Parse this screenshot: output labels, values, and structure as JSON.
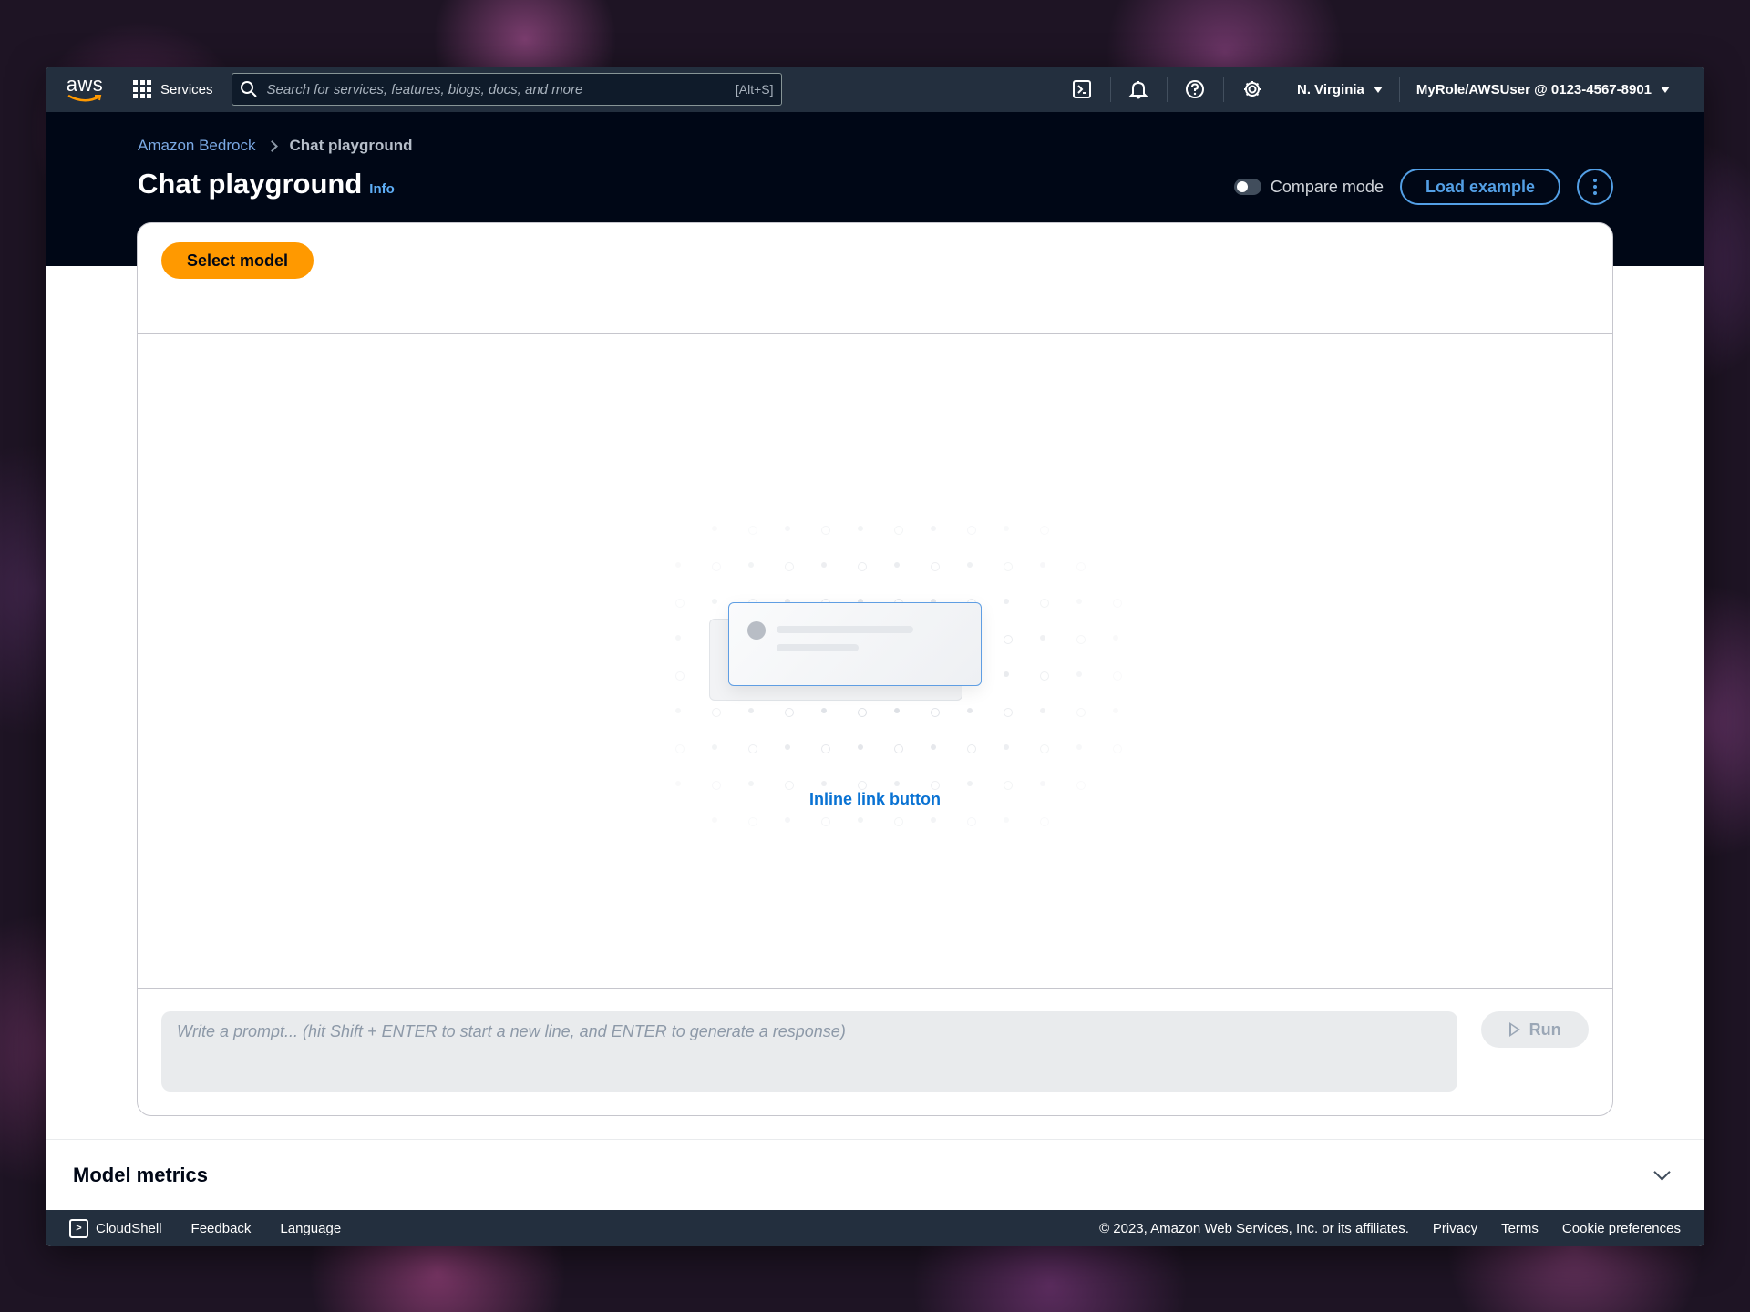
{
  "nav": {
    "logo": "aws",
    "services_label": "Services",
    "search_placeholder": "Search for services, features, blogs, docs, and more",
    "search_shortcut": "[Alt+S]",
    "icons": [
      "cloudshell-icon",
      "bell-icon",
      "help-icon",
      "gear-icon"
    ],
    "region": "N. Virginia",
    "account": "MyRole/AWSUser @ 0123-4567-8901"
  },
  "breadcrumb": {
    "parent": "Amazon Bedrock",
    "current": "Chat playground"
  },
  "header": {
    "title": "Chat playground",
    "info": "Info",
    "compare_mode": "Compare mode",
    "load_example": "Load example"
  },
  "playground": {
    "select_model": "Select model",
    "empty_link": "Inline link button",
    "prompt_placeholder": "Write a prompt... (hit Shift + ENTER to start a new line, and ENTER to generate a response)",
    "run": "Run"
  },
  "metrics": {
    "title": "Model metrics"
  },
  "footer": {
    "cloudshell": "CloudShell",
    "feedback": "Feedback",
    "language": "Language",
    "copyright": "© 2023, Amazon Web Services, Inc. or its affiliates.",
    "privacy": "Privacy",
    "terms": "Terms",
    "cookie": "Cookie preferences"
  },
  "colors": {
    "nav_bg": "#232f3e",
    "header_bg": "#000716",
    "accent": "#539fe5",
    "primary_button": "#ff9900",
    "link": "#0972d3"
  }
}
